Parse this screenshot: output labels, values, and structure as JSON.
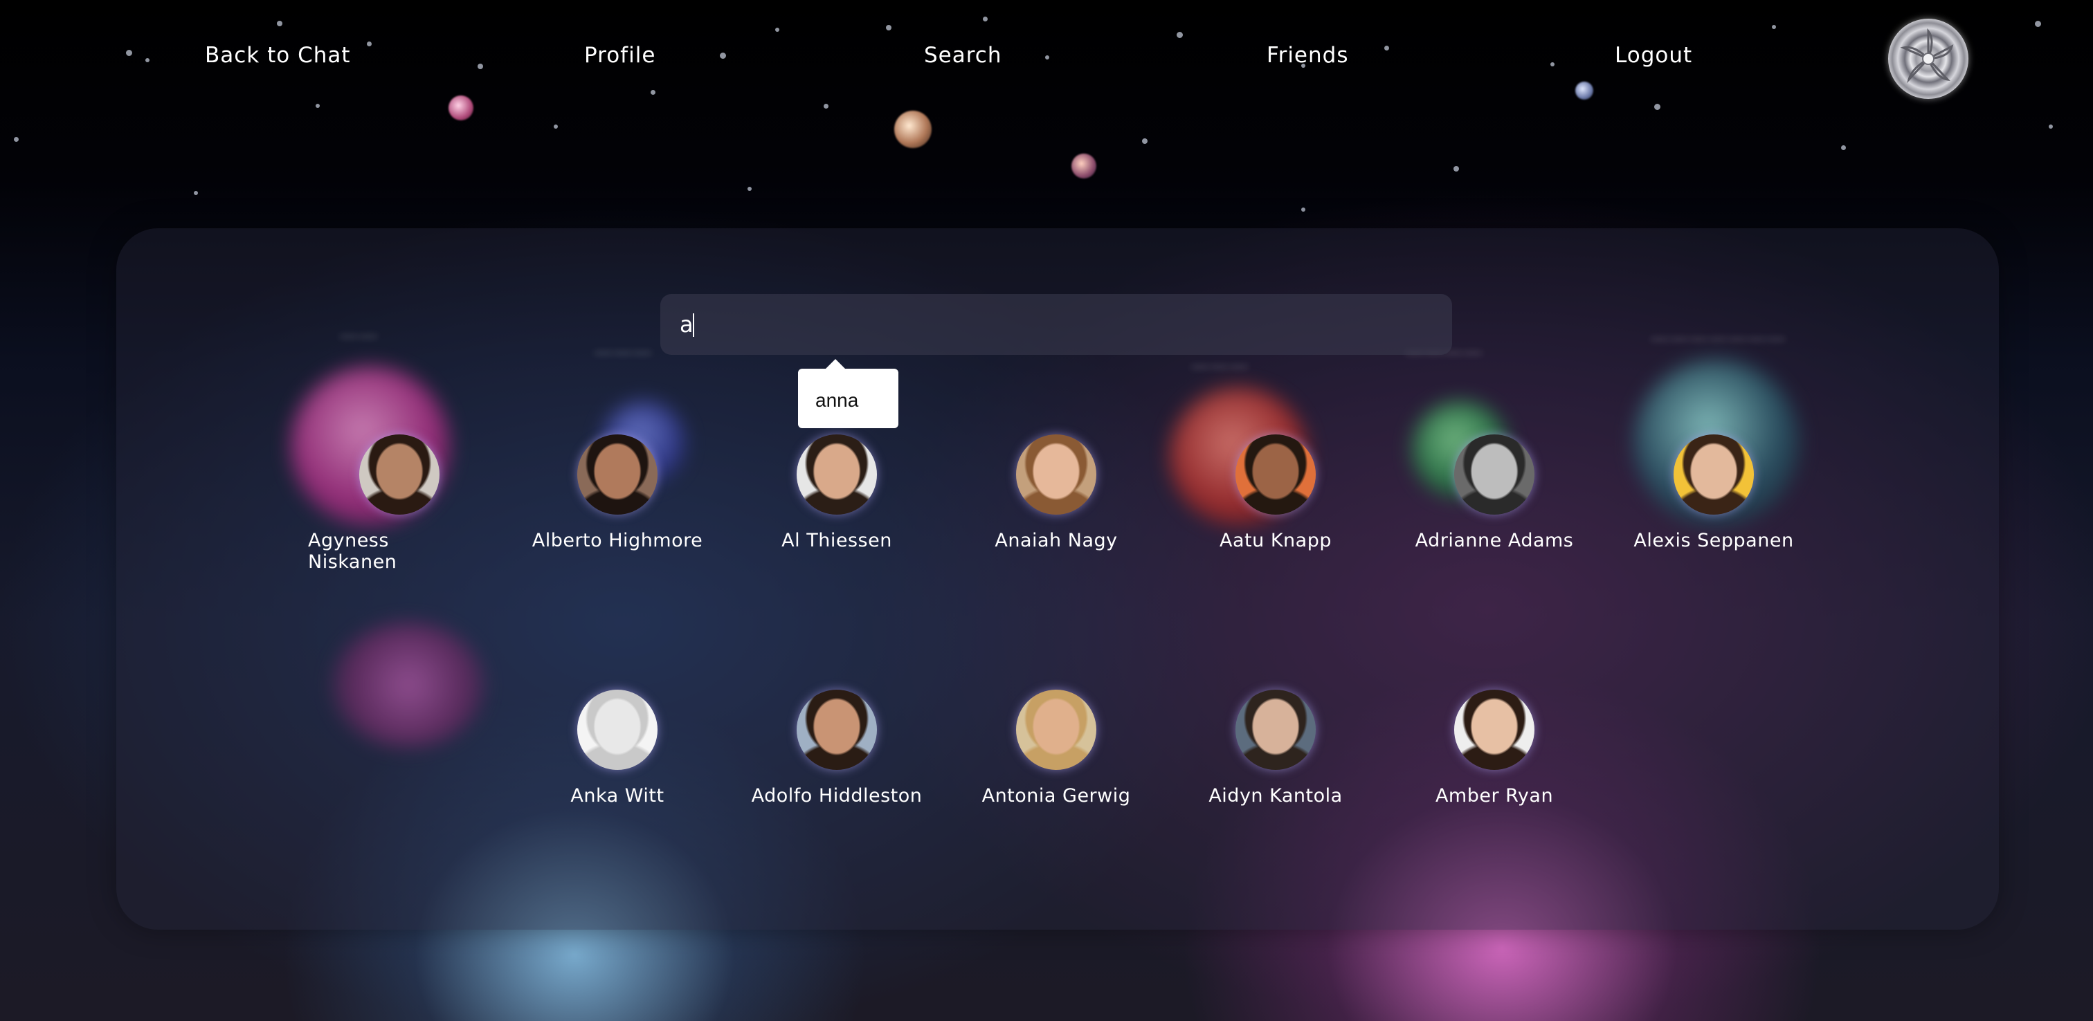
{
  "nav": {
    "back_label": "Back to Chat",
    "profile_label": "Profile",
    "search_label": "Search",
    "friends_label": "Friends",
    "logout_label": "Logout",
    "logo_icon": "silver-flower-logo-icon"
  },
  "search": {
    "value": "a",
    "placeholder": ""
  },
  "suggestions": [
    "anna"
  ],
  "users": [
    {
      "name": "Agyness Niskanen",
      "skin": "#b58466",
      "hair": "#2a1a12",
      "bg": "#cfc9c2"
    },
    {
      "name": "Alberto Highmore",
      "skin": "#b07a5c",
      "hair": "#1e1410",
      "bg": "#8a6a58"
    },
    {
      "name": "Al Thiessen",
      "skin": "#d9a98a",
      "hair": "#2b1e16",
      "bg": "#e6e6e6"
    },
    {
      "name": "Anaiah Nagy",
      "skin": "#e6b89a",
      "hair": "#8a5a34",
      "bg": "#c4a07c"
    },
    {
      "name": "Aatu Knapp",
      "skin": "#9c6446",
      "hair": "#241810",
      "bg": "#e0703a"
    },
    {
      "name": "Adrianne Adams",
      "skin": "#bdbdbd",
      "hair": "#2a2a2a",
      "bg": "#6a6a6a"
    },
    {
      "name": "Alexis Seppanen",
      "skin": "#e3b99c",
      "hair": "#3a2416",
      "bg": "#f2c238"
    },
    {
      "name": "Anka Witt",
      "skin": "#e8e8e8",
      "hair": "#c9c9c9",
      "bg": "#f4f4f4"
    },
    {
      "name": "Adolfo Hiddleston",
      "skin": "#c99474",
      "hair": "#2a1c14",
      "bg": "#9fb0c4"
    },
    {
      "name": "Antonia Gerwig",
      "skin": "#e0b08c",
      "hair": "#c7a064",
      "bg": "#d6c29a"
    },
    {
      "name": "Aidyn Kantola",
      "skin": "#d7b29a",
      "hair": "#2e241e",
      "bg": "#5c6c7e"
    },
    {
      "name": "Amber Ryan",
      "skin": "#e7c0a4",
      "hair": "#2c1c14",
      "bg": "#eeeeee"
    }
  ]
}
